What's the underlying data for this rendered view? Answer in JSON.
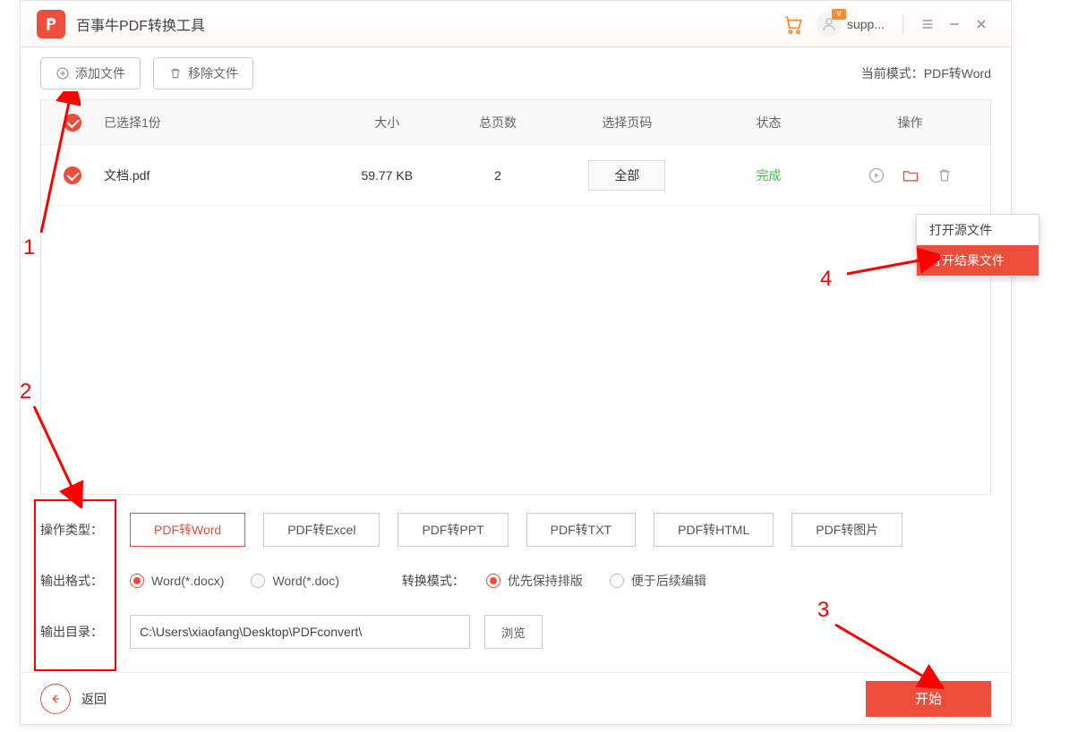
{
  "titlebar": {
    "app_title": "百事牛PDF转换工具",
    "user_label": "supp...",
    "badge": "V"
  },
  "toolbar": {
    "add_file": "添加文件",
    "remove_file": "移除文件",
    "mode_label_prefix": "当前模式：",
    "mode_label_value": "PDF转Word"
  },
  "table": {
    "headers": {
      "selected": "已选择1份",
      "size": "大小",
      "pages": "总页数",
      "page_range": "选择页码",
      "status": "状态",
      "actions": "操作"
    },
    "row": {
      "filename": "文档.pdf",
      "size": "59.77 KB",
      "pages": "2",
      "page_range": "全部",
      "status": "完成"
    }
  },
  "context_menu": {
    "open_source": "打开源文件",
    "open_result": "打开结果文件"
  },
  "settings": {
    "type_label": "操作类型：",
    "types": [
      "PDF转Word",
      "PDF转Excel",
      "PDF转PPT",
      "PDF转TXT",
      "PDF转HTML",
      "PDF转图片"
    ],
    "format_label": "输出格式：",
    "format_docx": "Word(*.docx)",
    "format_doc": "Word(*.doc)",
    "convmode_label": "转换模式：",
    "convmode_layout": "优先保持排版",
    "convmode_edit": "便于后续编辑",
    "dir_label": "输出目录：",
    "dir_value": "C:\\Users\\xiaofang\\Desktop\\PDFconvert\\",
    "browse": "浏览"
  },
  "bottombar": {
    "back": "返回",
    "start": "开始"
  },
  "annotations": {
    "n1": "1",
    "n2": "2",
    "n3": "3",
    "n4": "4"
  }
}
